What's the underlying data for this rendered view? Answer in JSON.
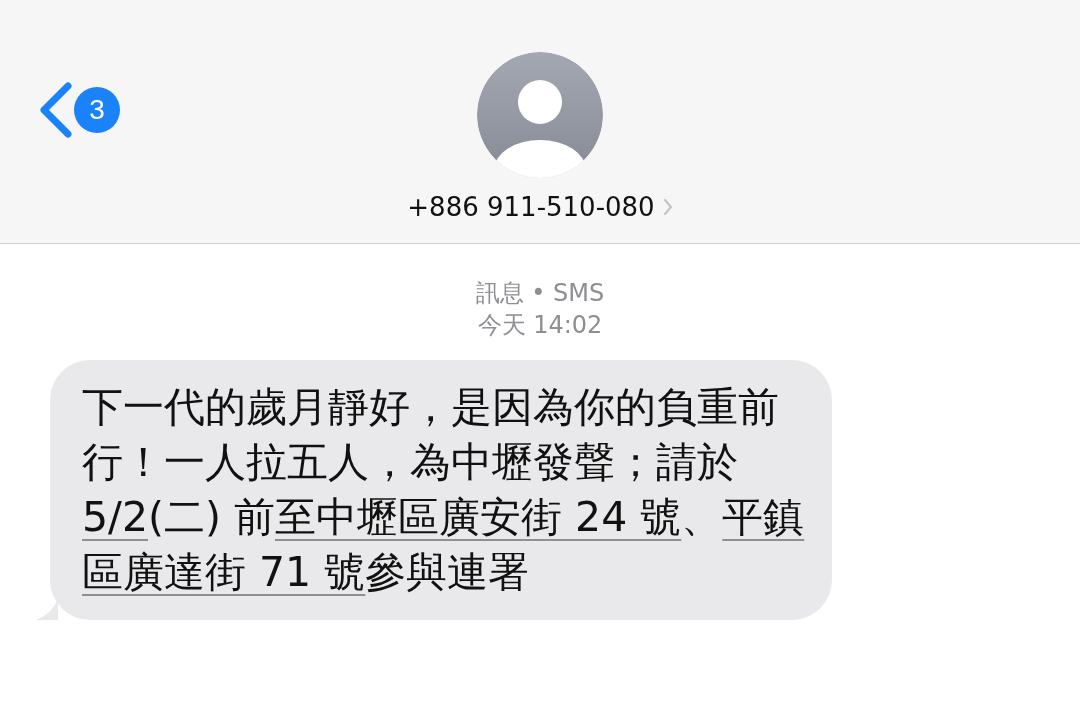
{
  "header": {
    "back_badge": "3",
    "contact": "+886 911-510-080"
  },
  "meta": {
    "service": "訊息 • SMS",
    "time": "今天 14:02"
  },
  "message": {
    "lines": [
      [
        {
          "text": "下一代的歲月靜好，是因為你的負重前",
          "link": false
        }
      ],
      [
        {
          "text": "行！一人拉五人，為中壢發聲；請於",
          "link": false
        }
      ],
      [
        {
          "text": "5/2",
          "link": true
        },
        {
          "text": "(二) 前",
          "link": false
        },
        {
          "text": "至中壢區廣安街 24 號",
          "link": true
        },
        {
          "text": "、",
          "link": false
        },
        {
          "text": "平鎮",
          "link": true
        }
      ],
      [
        {
          "text": "區廣達街 71 號",
          "link": true
        },
        {
          "text": "參與連署",
          "link": false
        }
      ]
    ]
  }
}
